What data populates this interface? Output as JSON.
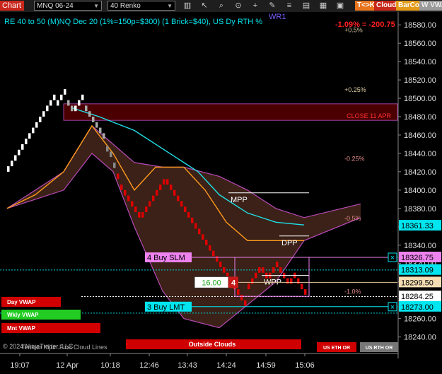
{
  "toolbar": {
    "chart_tab": "Chart",
    "instrument": "MNQ 06-24",
    "bar_type": "40 Renko",
    "buttons": {
      "tk": "T<>K",
      "cloud": "Cloud",
      "barcol": "BarCol",
      "vwa": "W VWA"
    },
    "icons": [
      "bars-icon",
      "cursor-icon",
      "zoom-in-icon",
      "crosshair-icon",
      "draw-icon",
      "chart-type-icon",
      "properties-icon",
      "strategy-icon",
      "indicator-icon",
      "template-icon"
    ]
  },
  "header": {
    "description": "RE 40 to 50 (M)NQ Dec 20 (1%=150p=$300) (1 Brick=$40), US Dy RTH %",
    "wr_label": "WR1",
    "pct_change": "-1.09% = -200.75"
  },
  "chart_data": {
    "type": "renko",
    "y_range": [
      18220,
      18600
    ],
    "y_ticks": [
      18580,
      18560,
      18540,
      18520,
      18500,
      18480,
      18460,
      18440,
      18420,
      18400,
      18380,
      18360,
      18340,
      18320,
      18300,
      18280,
      18260,
      18240
    ],
    "y_tick_labels": [
      "18580.00",
      "18560.00",
      "18540.00",
      "18520.00",
      "18500.00",
      "18480.00",
      "18460.00",
      "18440.00",
      "18420.00",
      "18400.00",
      "18380.00",
      "18360.00",
      "18340.00",
      "18320.00",
      "18300.00",
      "18280.00",
      "18260.00",
      "18240.00"
    ],
    "x_labels": [
      "19:07",
      "12 Apr",
      "10:18",
      "12:46",
      "13:43",
      "14:24",
      "14:59",
      "15:06"
    ],
    "price_tags": [
      {
        "value": 18361.33,
        "text": "18361.33",
        "bg": "#00e5ee",
        "fg": "#000"
      },
      {
        "value": 18326.75,
        "text": "18326.75",
        "bg": "#ee82ee",
        "fg": "#000"
      },
      {
        "value": 18313.09,
        "text": "18313.09",
        "bg": "#00e5ee",
        "fg": "#000"
      },
      {
        "value": 18299.5,
        "text": "18299.50",
        "bg": "#f5deb3",
        "fg": "#000"
      },
      {
        "value": 18284.25,
        "text": "18284.25",
        "bg": "#ffffff",
        "fg": "#000"
      },
      {
        "value": 18273.0,
        "text": "18273.00",
        "bg": "#00e5ee",
        "fg": "#000"
      }
    ],
    "pct_levels": [
      {
        "text": "+0.5%",
        "value": 18575
      },
      {
        "text": "+0.25%",
        "value": 18510
      },
      {
        "text": "-0.25%",
        "value": 18435
      },
      {
        "text": "-0.5%",
        "value": 18370
      },
      {
        "text": "-1.0%",
        "value": 18290
      }
    ],
    "close_zone": {
      "label": "CLOSE 11 APR",
      "top": 18494,
      "bottom": 18476
    },
    "levels": [
      {
        "name": "MPP",
        "value": 18397
      },
      {
        "name": "DPP",
        "value": 18350
      },
      {
        "name": "WPP",
        "value": 18307
      }
    ],
    "orders": [
      {
        "label": "4 Buy SLM",
        "value": 18326.75,
        "bg": "#ee82ee"
      },
      {
        "label": "3 Buy LMT",
        "value": 18273.0,
        "bg": "#00e5ee"
      }
    ],
    "position": {
      "price": "16.00",
      "qty": "4"
    },
    "side_labels": [
      {
        "text": "Day VWAP",
        "bg": "#d00000"
      },
      {
        "text": "Wkly VWAP",
        "bg": "#22cc22"
      },
      {
        "text": "Mnt VWAP",
        "bg": "#d00000"
      }
    ],
    "bottom_labels": {
      "outside_clouds": "Outside Clouds",
      "us_eth": "US ETH OR",
      "us_rth": "US RTH OR",
      "copyright": "© 2024 NinjaTrader, LLC",
      "first_lines": "Tenkan Kijun First Cloud Lines"
    },
    "bricks": [
      {
        "i": 0,
        "o": 18420,
        "c": 18426,
        "col": "#fff"
      },
      {
        "i": 1,
        "o": 18426,
        "c": 18432,
        "col": "#fff"
      },
      {
        "i": 2,
        "o": 18432,
        "c": 18438,
        "col": "#fff"
      },
      {
        "i": 3,
        "o": 18438,
        "c": 18444,
        "col": "#fff"
      },
      {
        "i": 4,
        "o": 18444,
        "c": 18450,
        "col": "#fff"
      },
      {
        "i": 5,
        "o": 18450,
        "c": 18456,
        "col": "#fff"
      },
      {
        "i": 6,
        "o": 18456,
        "c": 18462,
        "col": "#fff"
      },
      {
        "i": 7,
        "o": 18462,
        "c": 18468,
        "col": "#fff"
      },
      {
        "i": 8,
        "o": 18468,
        "c": 18474,
        "col": "#fff"
      },
      {
        "i": 9,
        "o": 18474,
        "c": 18480,
        "col": "#fff"
      },
      {
        "i": 10,
        "o": 18480,
        "c": 18486,
        "col": "#fff"
      },
      {
        "i": 11,
        "o": 18486,
        "c": 18492,
        "col": "#fff"
      },
      {
        "i": 12,
        "o": 18492,
        "c": 18498,
        "col": "#fff"
      },
      {
        "i": 13,
        "o": 18498,
        "c": 18504,
        "col": "#fff"
      },
      {
        "i": 14,
        "o": 18492,
        "c": 18498,
        "col": "#fff"
      },
      {
        "i": 15,
        "o": 18498,
        "c": 18504,
        "col": "#fff"
      },
      {
        "i": 16,
        "o": 18504,
        "c": 18510,
        "col": "#fff"
      },
      {
        "i": 17,
        "o": 18498,
        "c": 18492,
        "col": "#aaa"
      },
      {
        "i": 18,
        "o": 18492,
        "c": 18486,
        "col": "#aaa"
      },
      {
        "i": 19,
        "o": 18486,
        "c": 18492,
        "col": "#fff"
      },
      {
        "i": 20,
        "o": 18492,
        "c": 18498,
        "col": "#fff"
      },
      {
        "i": 21,
        "o": 18498,
        "c": 18504,
        "col": "#fff"
      },
      {
        "i": 22,
        "o": 18492,
        "c": 18486,
        "col": "#aaa"
      },
      {
        "i": 23,
        "o": 18486,
        "c": 18480,
        "col": "#aaa"
      },
      {
        "i": 24,
        "o": 18480,
        "c": 18474,
        "col": "#aaa"
      },
      {
        "i": 25,
        "o": 18474,
        "c": 18468,
        "col": "#aaa"
      },
      {
        "i": 26,
        "o": 18468,
        "c": 18462,
        "col": "#aaa"
      },
      {
        "i": 27,
        "o": 18462,
        "c": 18456,
        "col": "#aaa"
      },
      {
        "i": 28,
        "o": 18448,
        "c": 18442,
        "col": "#888"
      },
      {
        "i": 29,
        "o": 18442,
        "c": 18436,
        "col": "#888"
      },
      {
        "i": 30,
        "o": 18430,
        "c": 18424,
        "col": "#888"
      },
      {
        "i": 31,
        "o": 18418,
        "c": 18412,
        "col": "#d00"
      },
      {
        "i": 32,
        "o": 18406,
        "c": 18400,
        "col": "#d00"
      },
      {
        "i": 33,
        "o": 18400,
        "c": 18394,
        "col": "#d00"
      },
      {
        "i": 34,
        "o": 18394,
        "c": 18388,
        "col": "#d00"
      },
      {
        "i": 35,
        "o": 18388,
        "c": 18382,
        "col": "#d00"
      },
      {
        "i": 36,
        "o": 18382,
        "c": 18376,
        "col": "#d00"
      },
      {
        "i": 37,
        "o": 18376,
        "c": 18370,
        "col": "#d00"
      },
      {
        "i": 38,
        "o": 18370,
        "c": 18376,
        "col": "#d00"
      },
      {
        "i": 39,
        "o": 18376,
        "c": 18382,
        "col": "#d00"
      },
      {
        "i": 40,
        "o": 18382,
        "c": 18388,
        "col": "#d00"
      },
      {
        "i": 41,
        "o": 18388,
        "c": 18394,
        "col": "#d00"
      },
      {
        "i": 42,
        "o": 18394,
        "c": 18400,
        "col": "#d00"
      },
      {
        "i": 43,
        "o": 18400,
        "c": 18406,
        "col": "#d00"
      },
      {
        "i": 44,
        "o": 18406,
        "c": 18412,
        "col": "#d00"
      },
      {
        "i": 45,
        "o": 18412,
        "c": 18406,
        "col": "#d00"
      },
      {
        "i": 46,
        "o": 18406,
        "c": 18400,
        "col": "#d00"
      },
      {
        "i": 47,
        "o": 18400,
        "c": 18394,
        "col": "#d00"
      },
      {
        "i": 48,
        "o": 18394,
        "c": 18388,
        "col": "#d00"
      },
      {
        "i": 49,
        "o": 18388,
        "c": 18382,
        "col": "#d00"
      },
      {
        "i": 50,
        "o": 18382,
        "c": 18376,
        "col": "#d00"
      },
      {
        "i": 51,
        "o": 18376,
        "c": 18370,
        "col": "#d00"
      },
      {
        "i": 52,
        "o": 18370,
        "c": 18364,
        "col": "#d00"
      },
      {
        "i": 53,
        "o": 18364,
        "c": 18358,
        "col": "#d00"
      },
      {
        "i": 54,
        "o": 18358,
        "c": 18352,
        "col": "#d00"
      },
      {
        "i": 55,
        "o": 18352,
        "c": 18346,
        "col": "#d00"
      },
      {
        "i": 56,
        "o": 18346,
        "c": 18340,
        "col": "#d00"
      },
      {
        "i": 57,
        "o": 18340,
        "c": 18334,
        "col": "#d00"
      },
      {
        "i": 58,
        "o": 18334,
        "c": 18328,
        "col": "#d00"
      },
      {
        "i": 59,
        "o": 18328,
        "c": 18322,
        "col": "#d00"
      },
      {
        "i": 60,
        "o": 18322,
        "c": 18316,
        "col": "#d00"
      },
      {
        "i": 61,
        "o": 18316,
        "c": 18310,
        "col": "#d00"
      },
      {
        "i": 62,
        "o": 18310,
        "c": 18304,
        "col": "#d00"
      },
      {
        "i": 63,
        "o": 18304,
        "c": 18298,
        "col": "#d00"
      },
      {
        "i": 64,
        "o": 18298,
        "c": 18292,
        "col": "#d00"
      },
      {
        "i": 65,
        "o": 18292,
        "c": 18286,
        "col": "#d00"
      },
      {
        "i": 66,
        "o": 18286,
        "c": 18280,
        "col": "#d00"
      },
      {
        "i": 67,
        "o": 18280,
        "c": 18274,
        "col": "#d00"
      },
      {
        "i": 68,
        "o": 18292,
        "c": 18298,
        "col": "#d00"
      },
      {
        "i": 69,
        "o": 18298,
        "c": 18304,
        "col": "#d00"
      },
      {
        "i": 70,
        "o": 18304,
        "c": 18310,
        "col": "#d00"
      },
      {
        "i": 71,
        "o": 18310,
        "c": 18316,
        "col": "#d00"
      },
      {
        "i": 72,
        "o": 18316,
        "c": 18310,
        "col": "#d00"
      },
      {
        "i": 73,
        "o": 18310,
        "c": 18304,
        "col": "#d00"
      },
      {
        "i": 74,
        "o": 18304,
        "c": 18310,
        "col": "#d00"
      },
      {
        "i": 75,
        "o": 18310,
        "c": 18316,
        "col": "#d00"
      },
      {
        "i": 76,
        "o": 18316,
        "c": 18322,
        "col": "#d00"
      },
      {
        "i": 77,
        "o": 18316,
        "c": 18310,
        "col": "#d00"
      },
      {
        "i": 78,
        "o": 18310,
        "c": 18304,
        "col": "#d00"
      },
      {
        "i": 79,
        "o": 18304,
        "c": 18298,
        "col": "#d00"
      },
      {
        "i": 80,
        "o": 18298,
        "c": 18304,
        "col": "#d00"
      },
      {
        "i": 81,
        "o": 18304,
        "c": 18310,
        "col": "#d00"
      },
      {
        "i": 82,
        "o": 18304,
        "c": 18298,
        "col": "#d00"
      },
      {
        "i": 83,
        "o": 18298,
        "c": 18292,
        "col": "#d00"
      },
      {
        "i": 84,
        "o": 18292,
        "c": 18286,
        "col": "#d00"
      }
    ],
    "tenkan": [
      [
        0,
        18380
      ],
      [
        8,
        18395
      ],
      [
        16,
        18420
      ],
      [
        24,
        18470
      ],
      [
        30,
        18440
      ],
      [
        36,
        18400
      ],
      [
        42,
        18425
      ],
      [
        50,
        18425
      ],
      [
        56,
        18400
      ],
      [
        62,
        18365
      ],
      [
        68,
        18345
      ],
      [
        76,
        18345
      ],
      [
        84,
        18345
      ]
    ],
    "kijun": [
      [
        18,
        18490
      ],
      [
        26,
        18480
      ],
      [
        36,
        18465
      ],
      [
        46,
        18440
      ],
      [
        54,
        18420
      ],
      [
        60,
        18395
      ],
      [
        68,
        18375
      ],
      [
        76,
        18365
      ],
      [
        84,
        18362
      ]
    ],
    "cloud_top": [
      [
        0,
        18380
      ],
      [
        8,
        18400
      ],
      [
        16,
        18420
      ],
      [
        24,
        18470
      ],
      [
        30,
        18450
      ],
      [
        36,
        18430
      ],
      [
        44,
        18425
      ],
      [
        50,
        18425
      ],
      [
        60,
        18415
      ],
      [
        68,
        18400
      ],
      [
        76,
        18380
      ],
      [
        84,
        18370
      ],
      [
        100,
        18385
      ]
    ],
    "cloud_bottom": [
      [
        0,
        18380
      ],
      [
        8,
        18390
      ],
      [
        16,
        18400
      ],
      [
        24,
        18440
      ],
      [
        30,
        18420
      ],
      [
        36,
        18360
      ],
      [
        44,
        18290
      ],
      [
        50,
        18260
      ],
      [
        60,
        18250
      ],
      [
        68,
        18275
      ],
      [
        76,
        18300
      ],
      [
        84,
        18345
      ],
      [
        100,
        18370
      ]
    ]
  }
}
